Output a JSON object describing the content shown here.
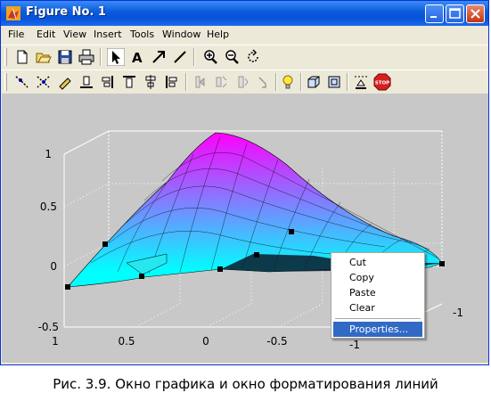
{
  "window": {
    "title": "Figure No. 1"
  },
  "menu": [
    "File",
    "Edit",
    "View",
    "Insert",
    "Tools",
    "Window",
    "Help"
  ],
  "toolbar1": [
    {
      "icon": "new-file-icon"
    },
    {
      "icon": "open-folder-icon"
    },
    {
      "icon": "save-icon"
    },
    {
      "icon": "print-icon"
    },
    {
      "icon": "arrow-pointer-icon"
    },
    {
      "icon": "text-a-icon"
    },
    {
      "icon": "draw-arrow-icon"
    },
    {
      "icon": "draw-line-icon"
    },
    {
      "icon": "zoom-in-icon"
    },
    {
      "icon": "zoom-out-icon"
    },
    {
      "icon": "rotate-3d-icon"
    }
  ],
  "toolbar2": [
    {
      "icon": "edit-line-icon"
    },
    {
      "icon": "edit-marker-icon"
    },
    {
      "icon": "edit-color-icon"
    },
    {
      "icon": "align-bottom-icon"
    },
    {
      "icon": "align-right-icon"
    },
    {
      "icon": "align-top-icon"
    },
    {
      "icon": "align-center-icon"
    },
    {
      "icon": "align-left-icon"
    },
    {
      "icon": "camera-move-icon"
    },
    {
      "icon": "camera-orbit-icon"
    },
    {
      "icon": "camera-roll-icon"
    },
    {
      "icon": "camera-dolly-icon"
    },
    {
      "icon": "light-bulb-icon"
    },
    {
      "icon": "projection-ortho-icon"
    },
    {
      "icon": "projection-persp-icon"
    },
    {
      "icon": "scene-light-icon"
    },
    {
      "icon": "stop-icon"
    }
  ],
  "stop_label": "STOP",
  "plot": {
    "z_ticks": [
      "1",
      "0.5",
      "0",
      "-0.5"
    ],
    "x_ticks": [
      "1",
      "0.5",
      "0",
      "-0.5",
      "-1"
    ],
    "y_ticks": [
      "-1"
    ],
    "colors": {
      "top": "#ff00ff",
      "bottom": "#00ffff",
      "background": "#c8c8c8"
    }
  },
  "context_menu": {
    "items": [
      "Cut",
      "Copy",
      "Paste",
      "Clear"
    ],
    "properties": "Properties..."
  },
  "caption": "Рис. 3.9. Окно графика и окно форматирования линий"
}
